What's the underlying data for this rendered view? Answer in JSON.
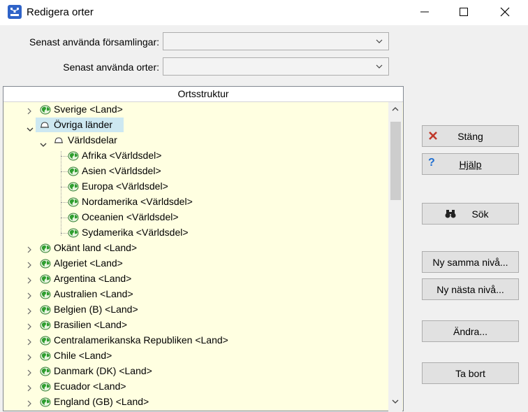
{
  "window": {
    "title": "Redigera orter"
  },
  "form": {
    "recent_parishes_label": "Senast använda församlingar:",
    "recent_places_label": "Senast använda orter:",
    "recent_parishes_value": "",
    "recent_places_value": ""
  },
  "tree": {
    "header": "Ortsstruktur",
    "rows": [
      {
        "label": "Sverige <Land>"
      },
      {
        "label": "Övriga länder"
      },
      {
        "label": "Världsdelar"
      },
      {
        "label": "Afrika <Världsdel>"
      },
      {
        "label": "Asien <Världsdel>"
      },
      {
        "label": "Europa <Världsdel>"
      },
      {
        "label": "Nordamerika <Världsdel>"
      },
      {
        "label": "Oceanien <Världsdel>"
      },
      {
        "label": "Sydamerika <Världsdel>"
      },
      {
        "label": "Okänt land <Land>"
      },
      {
        "label": "Algeriet <Land>"
      },
      {
        "label": "Argentina <Land>"
      },
      {
        "label": "Australien <Land>"
      },
      {
        "label": "Belgien (B) <Land>"
      },
      {
        "label": "Brasilien <Land>"
      },
      {
        "label": "Centralamerikanska Republiken <Land>"
      },
      {
        "label": "Chile <Land>"
      },
      {
        "label": "Danmark (DK) <Land>"
      },
      {
        "label": "Ecuador <Land>"
      },
      {
        "label": "England (GB) <Land>"
      }
    ]
  },
  "buttons": {
    "close": "Stäng",
    "help": "Hjälp",
    "search": "Sök",
    "new_same_level": "Ny samma nivå...",
    "new_next_level": "Ny nästa nivå...",
    "edit": "Ändra...",
    "delete": "Ta bort"
  },
  "colors": {
    "tree_background": "#ffffe1",
    "selection": "#cde8f1",
    "globe_green": "#2e9e2e",
    "close_red": "#c0392b",
    "help_blue": "#1f6fd1"
  }
}
